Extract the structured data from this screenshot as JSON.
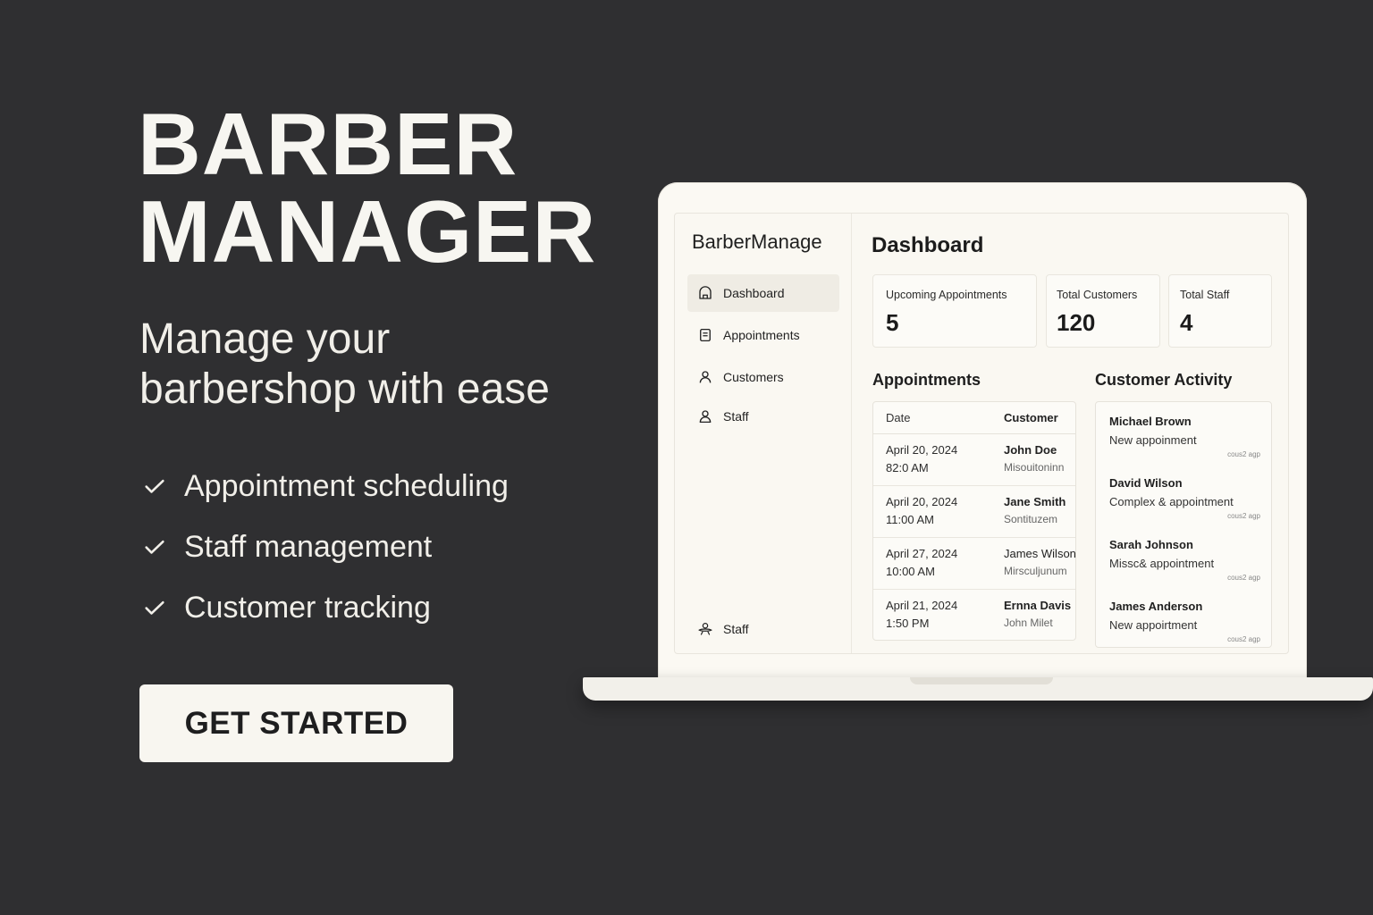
{
  "hero": {
    "title_line1": "BARBER",
    "title_line2": "MANAGER",
    "subtitle": "Manage your barbershop with ease",
    "features": [
      "Appointment scheduling",
      "Staff management",
      "Customer tracking"
    ],
    "cta_label": "GET STARTED"
  },
  "app": {
    "brand_part1": "Barber",
    "brand_part2": "Manage",
    "nav": [
      {
        "label": "Dashboard",
        "icon": "home-icon",
        "active": true
      },
      {
        "label": "Appointments",
        "icon": "document-icon"
      },
      {
        "label": "Customers",
        "icon": "user-icon"
      },
      {
        "label": "Staff",
        "icon": "user-icon"
      }
    ],
    "bottom_nav": {
      "label": "Staff",
      "icon": "staff-icon"
    },
    "page_title": "Dashboard",
    "stats": [
      {
        "label": "Upcoming Appointments",
        "value": "5"
      },
      {
        "label": "Total Customers",
        "value": "120"
      },
      {
        "label": "Total Staff",
        "value": "4"
      }
    ],
    "appointments": {
      "title": "Appointments",
      "columns": [
        "Date",
        "Customer"
      ],
      "rows": [
        {
          "date": "April 20, 2024",
          "time": "82:0 AM",
          "name": "John Doe",
          "sub": "Misouitoninn"
        },
        {
          "date": "April 20, 2024",
          "time": "11:00 AM",
          "name": "Jane Smith",
          "sub": "Sontituzem"
        },
        {
          "date": "April 27, 2024",
          "time": "10:00 AM",
          "name": "James Wilson",
          "sub": "Mirsculjunum"
        },
        {
          "date": "April 21, 2024",
          "time": "1:50 PM",
          "name": "Ernna Davis",
          "sub": "John Milet"
        }
      ]
    },
    "activity": {
      "title": "Customer Activity",
      "items": [
        {
          "name": "Michael Brown",
          "desc": "New appoinment",
          "time": "cous2 agp"
        },
        {
          "name": "David Wilson",
          "desc": "Complex & appointment",
          "time": "cous2 agp"
        },
        {
          "name": "Sarah Johnson",
          "desc": "Missc& appointment",
          "time": "cous2 agp"
        },
        {
          "name": "James Anderson",
          "desc": "New appoirtment",
          "time": "cous2 agp"
        }
      ]
    }
  }
}
